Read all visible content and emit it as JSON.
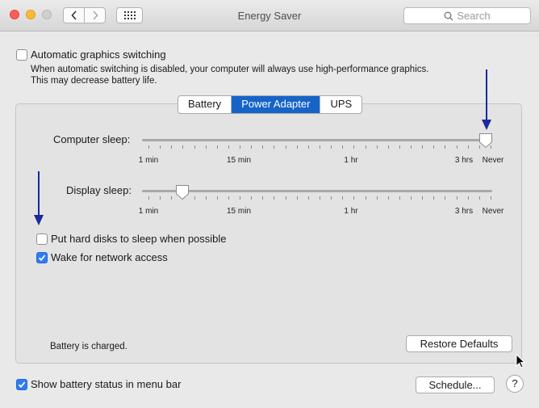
{
  "window": {
    "title": "Energy Saver"
  },
  "toolbar": {
    "search_placeholder": "Search"
  },
  "auto_graphics": {
    "label": "Automatic graphics switching",
    "checked": false,
    "description_line1": "When automatic switching is disabled, your computer will always use high-performance graphics.",
    "description_line2": "This may decrease battery life."
  },
  "tabs": [
    {
      "label": "Battery",
      "selected": false
    },
    {
      "label": "Power Adapter",
      "selected": true
    },
    {
      "label": "UPS",
      "selected": false
    }
  ],
  "computer_sleep": {
    "label": "Computer sleep:",
    "value": "Never",
    "tick_labels": [
      "1 min",
      "15 min",
      "1 hr",
      "3 hrs",
      "Never"
    ]
  },
  "display_sleep": {
    "label": "Display sleep:",
    "tick_labels": [
      "1 min",
      "15 min",
      "1 hr",
      "3 hrs",
      "Never"
    ]
  },
  "options": {
    "hard_disks": {
      "label": "Put hard disks to sleep when possible",
      "checked": false
    },
    "wake_network": {
      "label": "Wake for network access",
      "checked": true
    }
  },
  "status": {
    "battery_text": "Battery is charged."
  },
  "buttons": {
    "restore_defaults": "Restore Defaults",
    "schedule": "Schedule...",
    "help": "?"
  },
  "footer": {
    "show_battery": {
      "label": "Show battery status in menu bar",
      "checked": true
    }
  },
  "colors": {
    "accent": "#1664c8",
    "annotation_arrow": "#1a2a9c"
  }
}
